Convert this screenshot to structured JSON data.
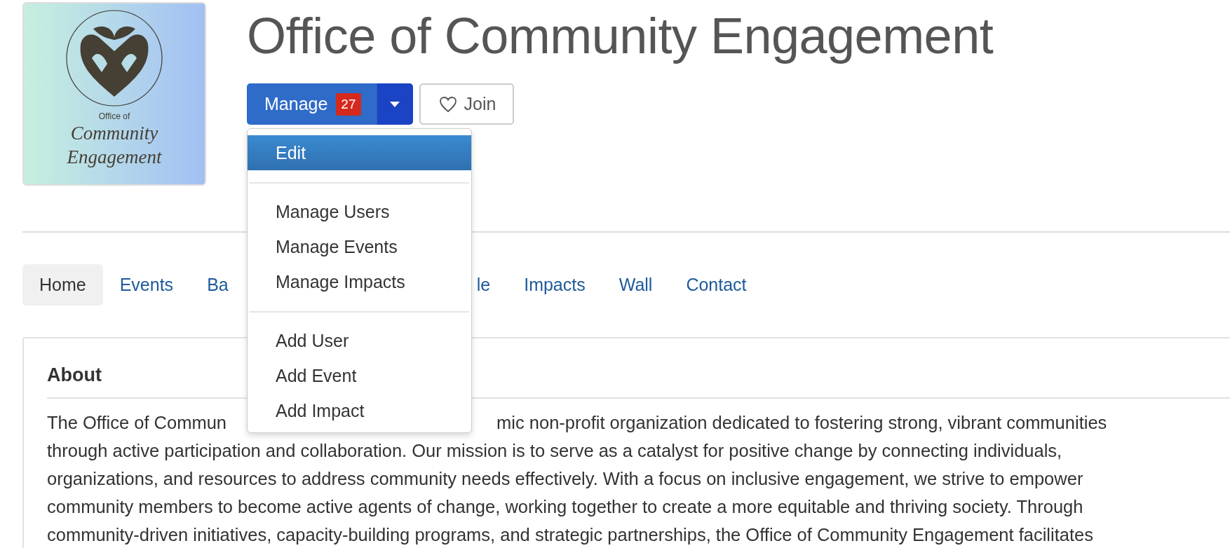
{
  "logo": {
    "lines": [
      "Office of",
      "Community",
      "Engagement"
    ]
  },
  "title": "Office of Community Engagement",
  "manage_button": {
    "label": "Manage",
    "badge": "27"
  },
  "join_button": {
    "label": "Join"
  },
  "dropdown": {
    "expanded": true,
    "groups": [
      [
        {
          "label": "Edit",
          "selected": true
        }
      ],
      [
        {
          "label": "Manage Users",
          "selected": false
        },
        {
          "label": "Manage Events",
          "selected": false
        },
        {
          "label": "Manage Impacts",
          "selected": false
        }
      ],
      [
        {
          "label": "Add User",
          "selected": false
        },
        {
          "label": "Add Event",
          "selected": false
        },
        {
          "label": "Add Impact",
          "selected": false
        }
      ]
    ]
  },
  "tabs": [
    {
      "label": "Home",
      "selected": true,
      "cut_right": false
    },
    {
      "label": "Events",
      "selected": false,
      "cut_right": false
    },
    {
      "label": "Ba",
      "selected": false,
      "cut_right": true
    },
    {
      "label": "le",
      "selected": false,
      "cut_right": false
    },
    {
      "label": "Impacts",
      "selected": false,
      "cut_right": false
    },
    {
      "label": "Wall",
      "selected": false,
      "cut_right": false
    },
    {
      "label": "Contact",
      "selected": false,
      "cut_right": false
    }
  ],
  "about": {
    "heading": "About",
    "lines": [
      [
        "The Office of Commun",
        "mic non-profit organization dedicated to fostering strong, vibrant communities"
      ],
      [
        "through active participation and collaboration. Our mission is to serve as a catalyst for positive change by connecting individuals,"
      ],
      [
        "organizations, and resources to address community needs effectively. With a focus on inclusive engagement, we strive to empower"
      ],
      [
        "community members to become active agents of change, working together to create a more equitable and thriving society. Through"
      ],
      [
        "community-driven initiatives, capacity-building programs, and strategic partnerships, the Office of Community Engagement facilitates"
      ]
    ]
  }
}
